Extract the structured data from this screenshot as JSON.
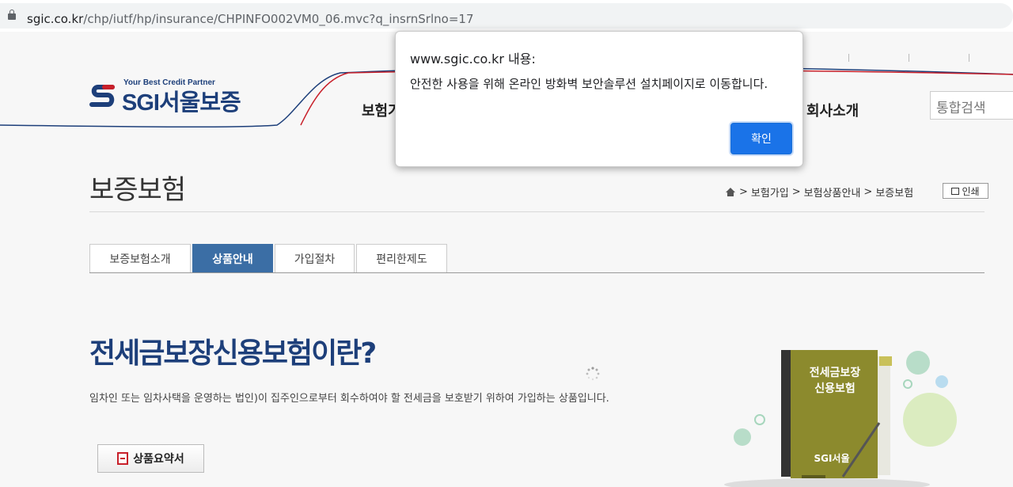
{
  "browser": {
    "url_host": "sgic.co.kr",
    "url_path": "/chp/iutf/hp/insurance/CHPINFO002VM0_06.mvc?q_insrnSrlno=17"
  },
  "header": {
    "logo_tagline": "Your Best Credit Partner",
    "logo_name": "SGI서울보증",
    "gnb_left": "보험가",
    "gnb_right": "회사소개",
    "search_placeholder": "통합검색"
  },
  "page": {
    "title": "보증보험",
    "breadcrumb": [
      "보험가입",
      "보험상품안내",
      "보증보험"
    ],
    "breadcrumb_sep": ">",
    "print_label": "인쇄",
    "tabs": [
      {
        "label": "보증보험소개",
        "active": false
      },
      {
        "label": "상품안내",
        "active": true
      },
      {
        "label": "가입절차",
        "active": false
      },
      {
        "label": "편리한제도",
        "active": false
      }
    ]
  },
  "product": {
    "heading": "전세금보장신용보험이란?",
    "description": "임차인 또는 임차사택을 운영하는 법인)이 집주인으로부터 회수하여야 할 전세금을 보호받기 위하여 가입하는 상품입니다.",
    "summary_button": "상품요약서",
    "book_title_line1": "전세금보장",
    "book_title_line2": "신용보험",
    "book_logo": "SGI서울"
  },
  "dialog": {
    "title": "www.sgic.co.kr 내용:",
    "message": "안전한 사용을 위해 온라인 방화벽 보안솔루션 설치페이지로 이동합니다.",
    "ok_label": "확인"
  },
  "colors": {
    "brand_blue": "#1d3f7a",
    "brand_red": "#c8202a",
    "tab_active": "#3b6ea5",
    "dialog_button": "#1a73e8"
  }
}
